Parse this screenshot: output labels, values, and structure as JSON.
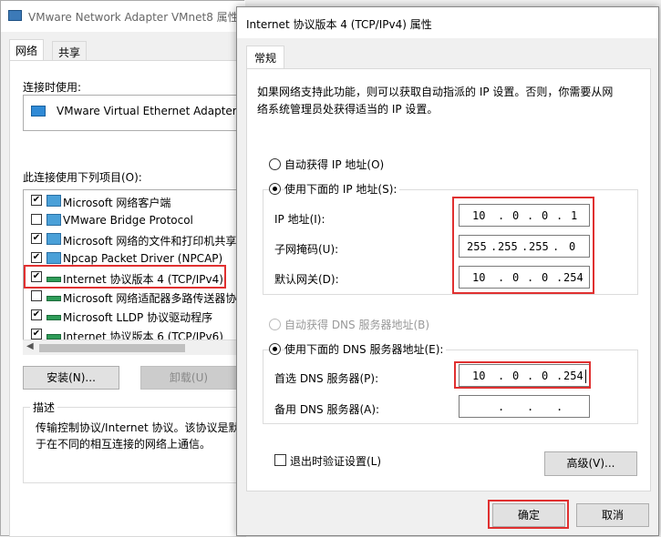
{
  "bg_window": {
    "title": "VMware Network Adapter VMnet8 属性",
    "tabs": [
      "网络",
      "共享"
    ],
    "connect_using_label": "连接时使用:",
    "adapter_name": "VMware Virtual Ethernet Adapter f",
    "items_label": "此连接使用下列项目(O):",
    "items": [
      {
        "label": "Microsoft 网络客户端",
        "checked": true
      },
      {
        "label": "VMware Bridge Protocol",
        "checked": false
      },
      {
        "label": "Microsoft 网络的文件和打印机共享",
        "checked": true
      },
      {
        "label": "Npcap Packet Driver (NPCAP)",
        "checked": true
      },
      {
        "label": "Internet 协议版本 4 (TCP/IPv4)",
        "checked": true
      },
      {
        "label": "Microsoft 网络适配器多路传送器协",
        "checked": false
      },
      {
        "label": "Microsoft LLDP 协议驱动程序",
        "checked": true
      },
      {
        "label": "Internet 协议版本 6 (TCP/IPv6)",
        "checked": true
      }
    ],
    "install_button": "安装(N)...",
    "uninstall_button": "卸载(U)",
    "description_title": "描述",
    "description_lines": [
      "传输控制协议/Internet 协议。该协议是默",
      "于在不同的相互连接的网络上通信。"
    ]
  },
  "dialog": {
    "title": "Internet 协议版本 4 (TCP/IPv4) 属性",
    "tab_general": "常规",
    "intro_lines": [
      "如果网络支持此功能，则可以获取自动指派的 IP 设置。否则，你需要从网",
      "络系统管理员处获得适当的 IP 设置。"
    ],
    "radio_auto_ip": "自动获得 IP 地址(O)",
    "radio_manual_ip": "使用下面的 IP 地址(S):",
    "ip_label": "IP 地址(I):",
    "subnet_label": "子网掩码(U):",
    "gateway_label": "默认网关(D):",
    "ip": [
      "10",
      "0",
      "0",
      "1"
    ],
    "subnet": [
      "255",
      "255",
      "255",
      "0"
    ],
    "gateway": [
      "10",
      "0",
      "0",
      "254"
    ],
    "radio_auto_dns": "自动获得 DNS 服务器地址(B)",
    "radio_manual_dns": "使用下面的 DNS 服务器地址(E):",
    "preferred_dns_label": "首选 DNS 服务器(P):",
    "alternate_dns_label": "备用 DNS 服务器(A):",
    "preferred_dns": [
      "10",
      "0",
      "0",
      "254"
    ],
    "validate_label": "退出时验证设置(L)",
    "advanced_button": "高级(V)...",
    "ok_button": "确定",
    "cancel_button": "取消",
    "highlight_color": "#e03030"
  }
}
